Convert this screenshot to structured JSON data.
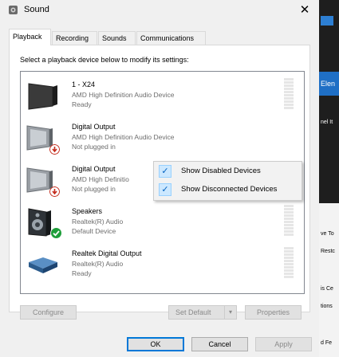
{
  "window": {
    "title": "Sound",
    "close_glyph": "✕"
  },
  "tabs": [
    {
      "label": "Playback",
      "active": true
    },
    {
      "label": "Recording",
      "active": false
    },
    {
      "label": "Sounds",
      "active": false
    },
    {
      "label": "Communications",
      "active": false
    }
  ],
  "instructions": "Select a playback device below to modify its settings:",
  "devices": [
    {
      "name": "1 - X24",
      "description": "AMD High Definition Audio Device",
      "status": "Ready",
      "icon": "monitor-icon",
      "badge": ""
    },
    {
      "name": "Digital Output",
      "description": "AMD High Definition Audio Device",
      "status": "Not plugged in",
      "icon": "display-icon",
      "badge": "unplugged"
    },
    {
      "name": "Digital Output",
      "description": "AMD High Definitio",
      "status": "Not plugged in",
      "icon": "display-icon",
      "badge": "unplugged"
    },
    {
      "name": "Speakers",
      "description": "Realtek(R) Audio",
      "status": "Default Device",
      "icon": "speaker-icon",
      "badge": "default"
    },
    {
      "name": "Realtek Digital Output",
      "description": "Realtek(R) Audio",
      "status": "Ready",
      "icon": "digital-output-icon",
      "badge": ""
    }
  ],
  "context_menu": [
    {
      "label": "Show Disabled Devices",
      "checked": true
    },
    {
      "label": "Show Disconnected Devices",
      "checked": true
    }
  ],
  "buttons": {
    "configure": "Configure",
    "set_default": "Set Default",
    "properties": "Properties",
    "ok": "OK",
    "cancel": "Cancel",
    "apply": "Apply"
  },
  "background_app": {
    "snippets": [
      "Elen",
      "nel It",
      "ve To",
      "Restc",
      "is Ce",
      "tions",
      "d Fe"
    ]
  },
  "colors": {
    "accent": "#0078d7",
    "default_badge": "#1e9e3a",
    "unplugged_badge": "#c42b1c"
  }
}
